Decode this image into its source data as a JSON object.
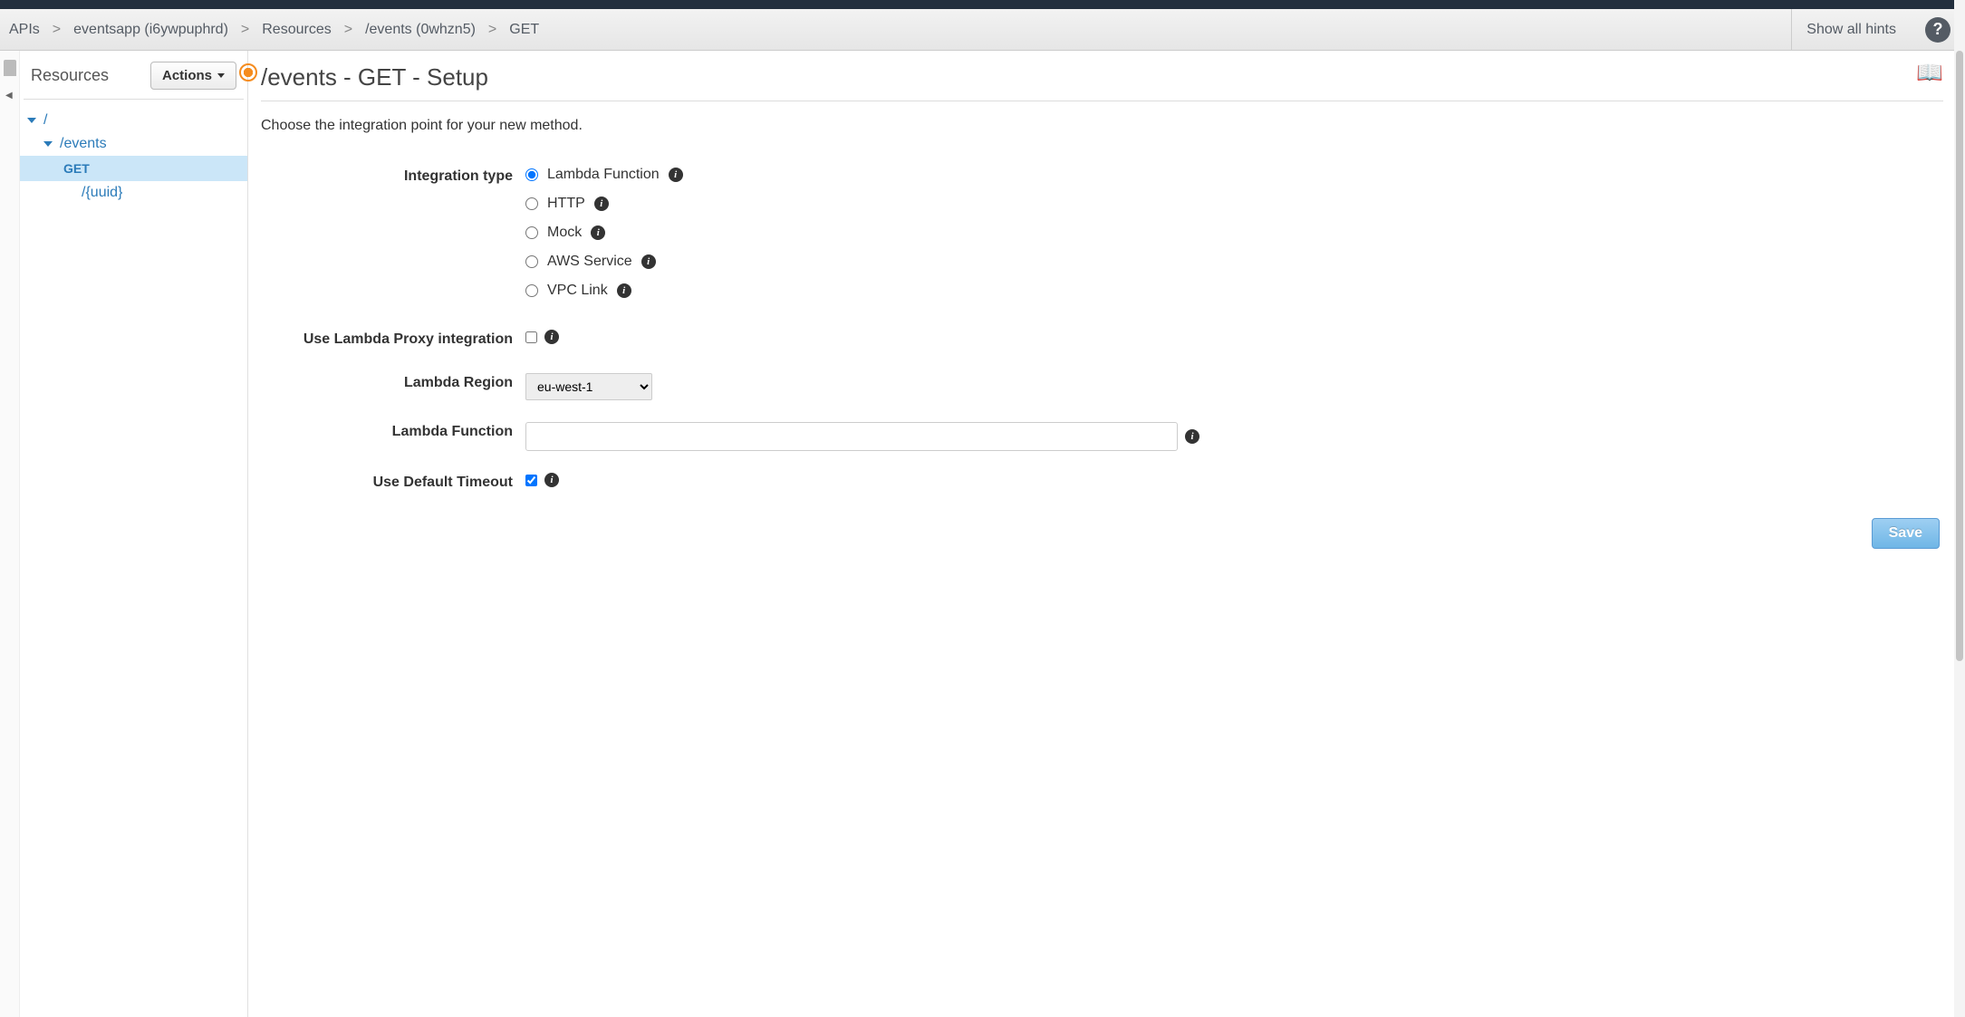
{
  "breadcrumbs": {
    "items": [
      "APIs",
      "eventsapp (i6ywpuphrd)",
      "Resources",
      "/events (0whzn5)",
      "GET"
    ]
  },
  "header": {
    "show_hints": "Show all hints"
  },
  "sidebar": {
    "title": "Resources",
    "actions_label": "Actions",
    "tree": {
      "root": "/",
      "events": "/events",
      "get": "GET",
      "uuid": "/{uuid}"
    }
  },
  "page": {
    "title": "/events - GET - Setup",
    "subtitle": "Choose the integration point for your new method."
  },
  "form": {
    "integration_type": {
      "label": "Integration type",
      "options": {
        "lambda": "Lambda Function",
        "http": "HTTP",
        "mock": "Mock",
        "aws": "AWS Service",
        "vpc": "VPC Link"
      },
      "selected": "lambda"
    },
    "proxy": {
      "label": "Use Lambda Proxy integration",
      "checked": false
    },
    "region": {
      "label": "Lambda Region",
      "value": "eu-west-1"
    },
    "function": {
      "label": "Lambda Function",
      "value": ""
    },
    "timeout": {
      "label": "Use Default Timeout",
      "checked": true
    },
    "save": "Save"
  }
}
